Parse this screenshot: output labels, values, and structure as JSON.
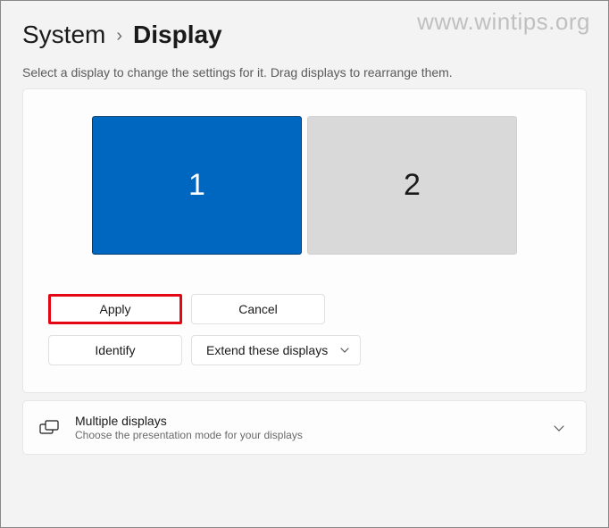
{
  "watermark": "www.wintips.org",
  "breadcrumb": {
    "parent": "System",
    "current": "Display"
  },
  "instruction": "Select a display to change the settings for it. Drag displays to rearrange them.",
  "monitors": [
    {
      "label": "1",
      "selected": true
    },
    {
      "label": "2",
      "selected": false
    }
  ],
  "buttons": {
    "apply": "Apply",
    "cancel": "Cancel",
    "identify": "Identify",
    "extend": "Extend these displays"
  },
  "multipleDisplays": {
    "title": "Multiple displays",
    "subtitle": "Choose the presentation mode for your displays"
  }
}
